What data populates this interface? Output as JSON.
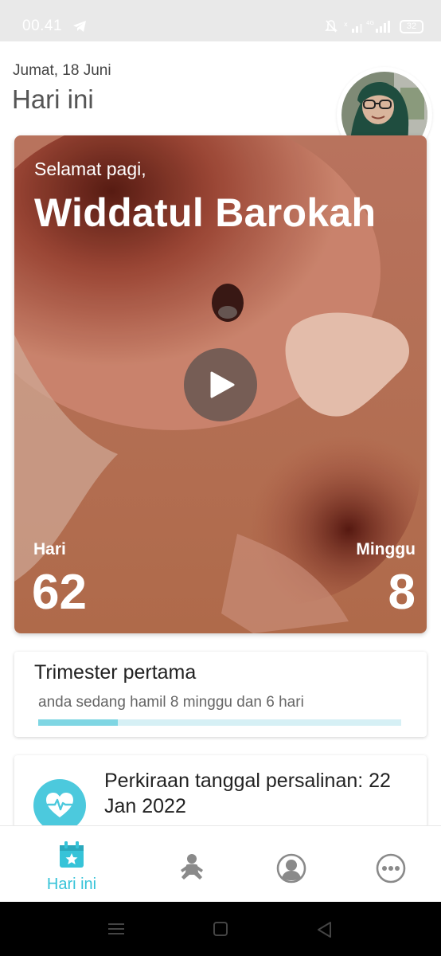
{
  "status_bar": {
    "time": "00.41",
    "battery": "32",
    "icons": [
      "telegram-icon",
      "mute-icon",
      "signal-icon",
      "battery-icon"
    ]
  },
  "header": {
    "date": "Jumat, 18 Juni",
    "title": "Hari ini"
  },
  "hero": {
    "greeting": "Selamat pagi,",
    "name": "Widdatul Barokah",
    "days_label": "Hari",
    "days_value": "62",
    "weeks_label": "Minggu",
    "weeks_value": "8"
  },
  "trimester": {
    "title": "Trimester pertama",
    "subtitle": "anda sedang hamil 8 minggu dan 6 hari",
    "progress": 0.22
  },
  "due_date": {
    "text": "Perkiraan tanggal persalinan: 22 Jan 2022"
  },
  "bottom_nav": {
    "items": [
      {
        "label": "Hari ini",
        "icon": "calendar-star-icon",
        "active": true
      },
      {
        "label": "",
        "icon": "baby-icon",
        "active": false
      },
      {
        "label": "",
        "icon": "profile-bust-icon",
        "active": false
      },
      {
        "label": "",
        "icon": "more-dots-icon",
        "active": false
      }
    ]
  },
  "colors": {
    "accent": "#36c3d8",
    "progress_fill": "#7fd6e3",
    "progress_track": "#d6f0f5",
    "heart_circle": "#4cc9dd",
    "nav_icon": "#8a8a8a"
  }
}
